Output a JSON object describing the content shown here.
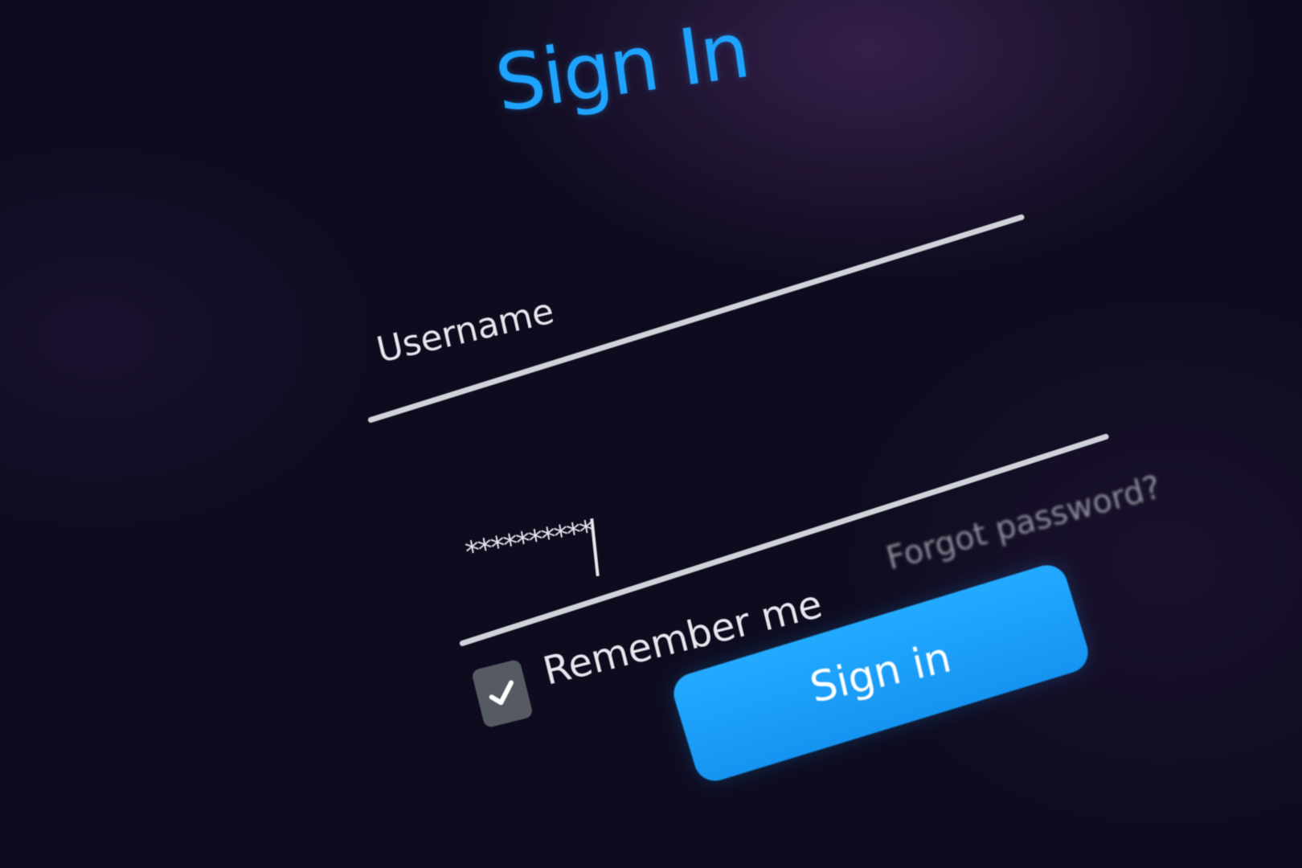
{
  "page": {
    "title": "Sign In"
  },
  "form": {
    "username": {
      "placeholder": "Username",
      "value": ""
    },
    "password": {
      "value": "**********"
    },
    "forgot_password_label": "Forgot password?",
    "remember_me": {
      "label": "Remember me",
      "checked": true
    },
    "submit_label": "Sign in"
  },
  "colors": {
    "accent": "#1ea4ff",
    "background": "#0e0b1e",
    "text": "#e6e8ee",
    "muted_text": "#8b8d97",
    "checkbox": "#565a63"
  },
  "icons": {
    "checkbox_mark": "check-icon"
  }
}
